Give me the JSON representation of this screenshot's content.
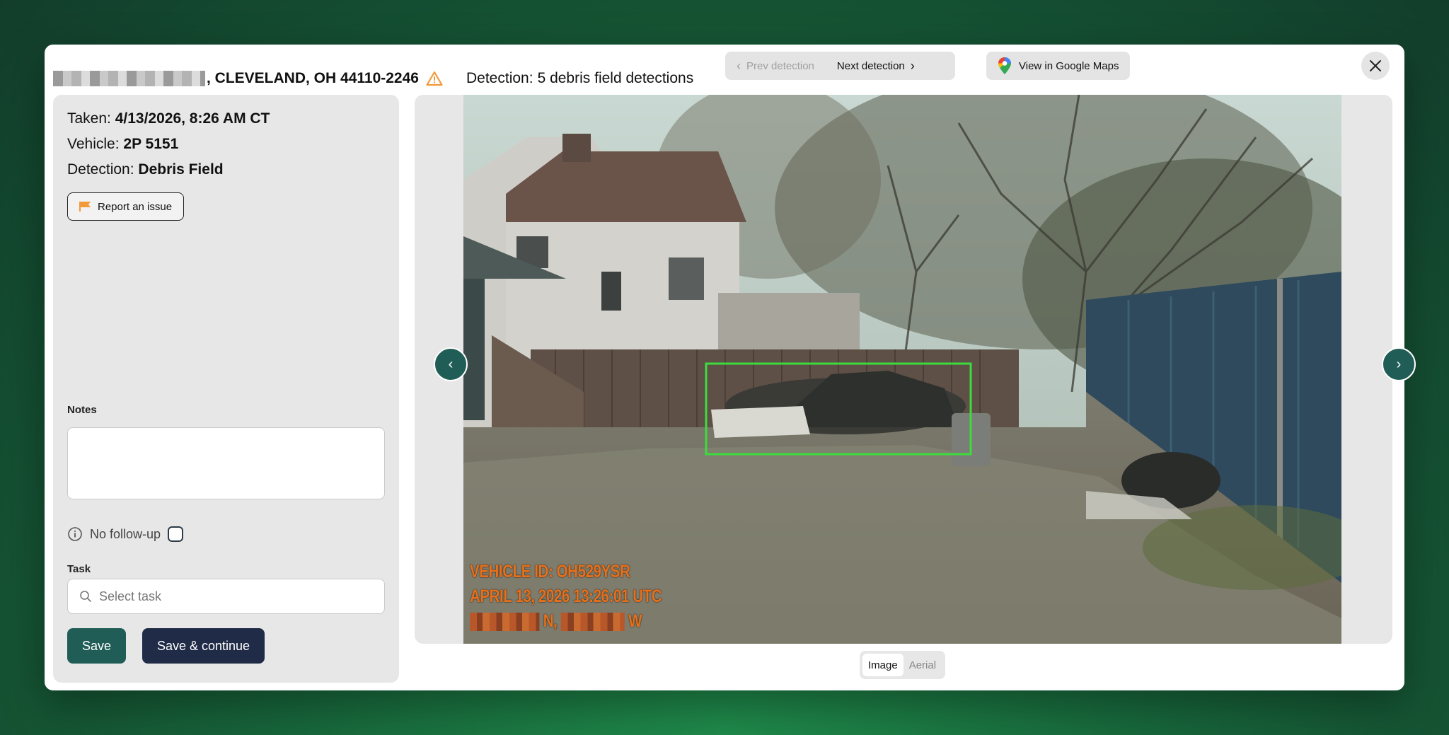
{
  "header": {
    "address": ", CLEVELAND, OH 44110-2246",
    "detection_prefix": "Detection:",
    "detection_value": "5 debris field detections",
    "prev_label": "Prev detection",
    "next_label": "Next detection",
    "maps_label": "View in Google Maps"
  },
  "details": {
    "taken_label": "Taken:",
    "taken_value": "4/13/2026, 8:26 AM CT",
    "vehicle_label": "Vehicle:",
    "vehicle_value": "2P 5151",
    "detection_label": "Detection:",
    "detection_value": "Debris Field",
    "report_label": "Report an issue"
  },
  "form": {
    "notes_label": "Notes",
    "notes_value": "",
    "followup_label": "No follow-up",
    "followup_checked": false,
    "task_label": "Task",
    "task_placeholder": "Select task",
    "save_label": "Save",
    "save_continue_label": "Save & continue"
  },
  "image": {
    "overlay_vehicle": "VEHICLE ID: OH529YSR",
    "overlay_time": "APRIL 13, 2026 13:26:01 UTC",
    "overlay_north": "N,",
    "overlay_west": "W",
    "detection_box_color": "#3ddc3d"
  },
  "view_toggle": {
    "image_label": "Image",
    "aerial_label": "Aerial",
    "active": "Image"
  },
  "colors": {
    "primary_teal": "#1f5d56",
    "navy": "#1f2b47",
    "warning_orange": "#f29a3a"
  }
}
